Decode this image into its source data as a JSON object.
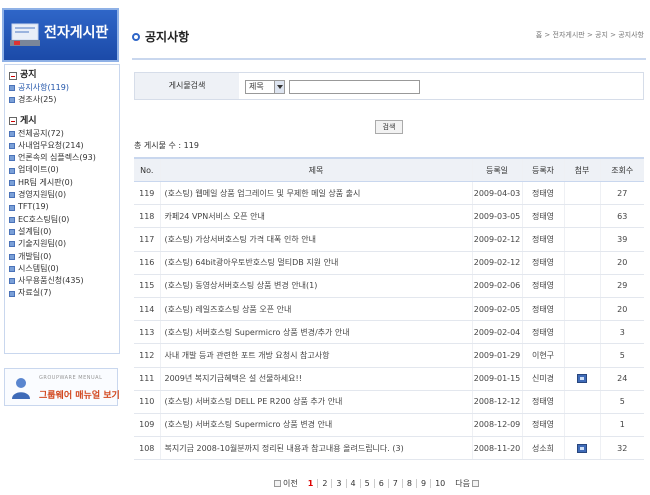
{
  "sidebar": {
    "brand_title": "전자게시판",
    "brand_sub": "",
    "sections": [
      {
        "title": "공지",
        "items": [
          {
            "label": "공지사항(119)",
            "active": true
          },
          {
            "label": "경조사(25)"
          }
        ]
      },
      {
        "title": "게시",
        "items": [
          {
            "label": "전체공지(72)"
          },
          {
            "label": "사내업무요청(214)"
          },
          {
            "label": "언론속의 심플렉스(93)"
          },
          {
            "label": "업데이트(0)"
          },
          {
            "label": "HR팀 게시판(0)"
          },
          {
            "label": "경영지원팀(0)"
          },
          {
            "label": "TFT(19)"
          },
          {
            "label": "EC호스팅팀(0)"
          },
          {
            "label": "설계팀(0)"
          },
          {
            "label": "기술지원팀(0)"
          },
          {
            "label": "개발팀(0)"
          },
          {
            "label": "시스템팀(0)"
          },
          {
            "label": "사무용품신청(435)"
          },
          {
            "label": "자료실(7)"
          }
        ]
      }
    ],
    "banner_small": "GROUPWARE MENUAL",
    "banner_text": "그룹웨어 매뉴얼 보기"
  },
  "header": {
    "title": "공지사항",
    "breadcrumb": "홈 > 전자게시판 > 공지 > 공지사항"
  },
  "search": {
    "label": "게시물검색",
    "select_value": "제목",
    "button": "검색"
  },
  "count_text": "총 게시물 수 : 119",
  "table": {
    "headers": [
      "No.",
      "제목",
      "등록일",
      "등록자",
      "첨부",
      "조회수"
    ],
    "rows": [
      {
        "no": "119",
        "subject": "(호스팅) 웹메일 상품 업그레이드 및 무제한 메일 상품 출시",
        "date": "2009-04-03",
        "author": "정태영",
        "attach": false,
        "views": "27"
      },
      {
        "no": "118",
        "subject": "카페24 VPN서비스 오픈 안내",
        "date": "2009-03-05",
        "author": "정태영",
        "attach": false,
        "views": "63"
      },
      {
        "no": "117",
        "subject": "(호스팅) 가상서버호스팅 가격 대폭 인하 안내",
        "date": "2009-02-12",
        "author": "정태영",
        "attach": false,
        "views": "39"
      },
      {
        "no": "116",
        "subject": "(호스팅) 64bit광아우토반호스팅 멀티DB 지원 안내",
        "date": "2009-02-12",
        "author": "정태영",
        "attach": false,
        "views": "20"
      },
      {
        "no": "115",
        "subject": "(호스팅) 동영상서버호스팅 상품 변경 안내(1)",
        "date": "2009-02-06",
        "author": "정태영",
        "attach": false,
        "views": "29"
      },
      {
        "no": "114",
        "subject": "(호스팅) 레일즈호스팅 상품 오픈 안내",
        "date": "2009-02-05",
        "author": "정태영",
        "attach": false,
        "views": "20"
      },
      {
        "no": "113",
        "subject": "(호스팅) 서버호스팅 Supermicro 상품 변경/추가 안내",
        "date": "2009-02-04",
        "author": "정태영",
        "attach": false,
        "views": "3"
      },
      {
        "no": "112",
        "subject": "사내 개발 등과 관련한 포트 개방 요청시 참고사항",
        "date": "2009-01-29",
        "author": "이현구",
        "attach": false,
        "views": "5"
      },
      {
        "no": "111",
        "subject": "2009년 복지기금혜택은 설 선물하세요!!",
        "date": "2009-01-15",
        "author": "신미경",
        "attach": true,
        "views": "24"
      },
      {
        "no": "110",
        "subject": "(호스팅) 서버호스팅 DELL PE R200 상품 추가 안내",
        "date": "2008-12-12",
        "author": "정태영",
        "attach": false,
        "views": "5"
      },
      {
        "no": "109",
        "subject": "(호스팅) 서버호스팅 Supermicro 상품 변경 안내",
        "date": "2008-12-09",
        "author": "정태영",
        "attach": false,
        "views": "1"
      },
      {
        "no": "108",
        "subject": "복지기금 2008-10월분까지 정리된 내용과 참고내용 올려드립니다. (3)",
        "date": "2008-11-20",
        "author": "성소희",
        "attach": true,
        "views": "32"
      }
    ]
  },
  "pager": {
    "prev": "이전",
    "next": "다음",
    "pages": [
      "1",
      "2",
      "3",
      "4",
      "5",
      "6",
      "7",
      "8",
      "9",
      "10"
    ],
    "current": "1"
  }
}
